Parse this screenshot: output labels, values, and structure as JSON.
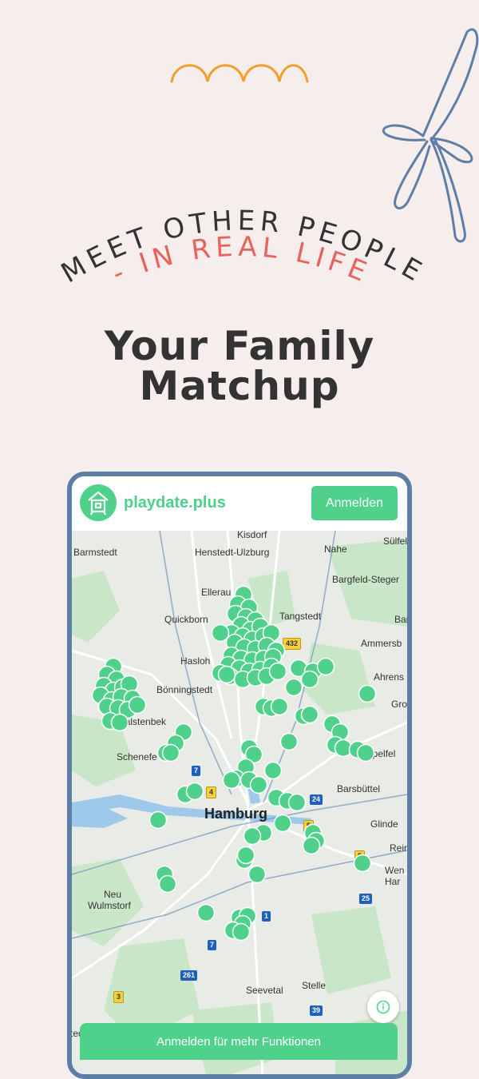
{
  "arc_top": "MEET OTHER PEOPLE",
  "arc_sub": "- IN REAL LIFE",
  "headline": {
    "line1": "Your Family",
    "line2": "Matchup"
  },
  "colors": {
    "background": "#f6eeec",
    "accent_green": "#4fd18b",
    "coral": "#e8635e",
    "frame_blue": "#5f7ea6",
    "swirl_orange": "#f0a02a"
  },
  "app": {
    "brand": "playdate.plus",
    "login_label": "Anmelden",
    "logo_icon": "house-icon",
    "bottom_label": "Anmelden für mehr Funktionen",
    "info_icon": "info-icon"
  },
  "map": {
    "city": "Hamburg",
    "places": [
      "Kisdorf",
      "Barmstedt",
      "Henstedt-Ulzburg",
      "Nahe",
      "Sülfel",
      "Bargfeld-Steger",
      "Ellerau",
      "Quickborn",
      "Tangstedt",
      "Bar",
      "Ammersb",
      "Hasloh",
      "Ahrens",
      "Bönningstedt",
      "Gro",
      "Halstenbek",
      "Schenefe",
      "apelfel",
      "Barsbüttel",
      "Glinde",
      "Rein",
      "Wen",
      "Har",
      "Neu",
      "Wulmstorf",
      "Seevetal",
      "Stelle",
      "tedt"
    ],
    "shields": [
      "432",
      "7",
      "4",
      "24",
      "5",
      "5",
      "25",
      "1",
      "7",
      "261",
      "3",
      "39"
    ]
  }
}
